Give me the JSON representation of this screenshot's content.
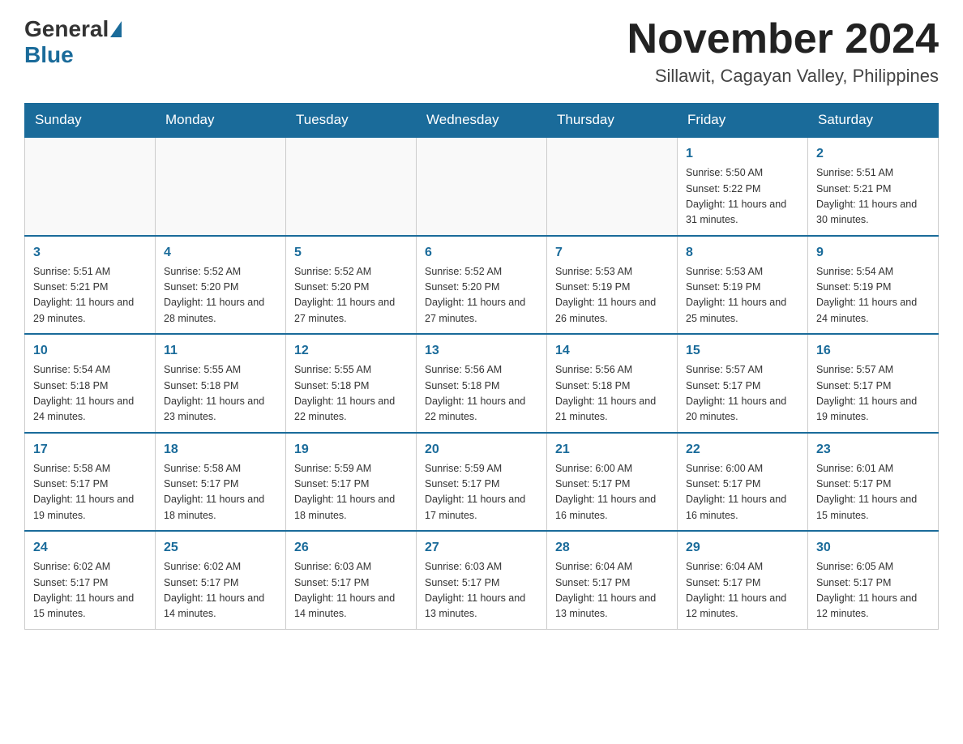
{
  "header": {
    "logo_general": "General",
    "logo_blue": "Blue",
    "month_title": "November 2024",
    "location": "Sillawit, Cagayan Valley, Philippines"
  },
  "weekdays": [
    "Sunday",
    "Monday",
    "Tuesday",
    "Wednesday",
    "Thursday",
    "Friday",
    "Saturday"
  ],
  "weeks": [
    [
      {
        "day": "",
        "info": ""
      },
      {
        "day": "",
        "info": ""
      },
      {
        "day": "",
        "info": ""
      },
      {
        "day": "",
        "info": ""
      },
      {
        "day": "",
        "info": ""
      },
      {
        "day": "1",
        "info": "Sunrise: 5:50 AM\nSunset: 5:22 PM\nDaylight: 11 hours and 31 minutes."
      },
      {
        "day": "2",
        "info": "Sunrise: 5:51 AM\nSunset: 5:21 PM\nDaylight: 11 hours and 30 minutes."
      }
    ],
    [
      {
        "day": "3",
        "info": "Sunrise: 5:51 AM\nSunset: 5:21 PM\nDaylight: 11 hours and 29 minutes."
      },
      {
        "day": "4",
        "info": "Sunrise: 5:52 AM\nSunset: 5:20 PM\nDaylight: 11 hours and 28 minutes."
      },
      {
        "day": "5",
        "info": "Sunrise: 5:52 AM\nSunset: 5:20 PM\nDaylight: 11 hours and 27 minutes."
      },
      {
        "day": "6",
        "info": "Sunrise: 5:52 AM\nSunset: 5:20 PM\nDaylight: 11 hours and 27 minutes."
      },
      {
        "day": "7",
        "info": "Sunrise: 5:53 AM\nSunset: 5:19 PM\nDaylight: 11 hours and 26 minutes."
      },
      {
        "day": "8",
        "info": "Sunrise: 5:53 AM\nSunset: 5:19 PM\nDaylight: 11 hours and 25 minutes."
      },
      {
        "day": "9",
        "info": "Sunrise: 5:54 AM\nSunset: 5:19 PM\nDaylight: 11 hours and 24 minutes."
      }
    ],
    [
      {
        "day": "10",
        "info": "Sunrise: 5:54 AM\nSunset: 5:18 PM\nDaylight: 11 hours and 24 minutes."
      },
      {
        "day": "11",
        "info": "Sunrise: 5:55 AM\nSunset: 5:18 PM\nDaylight: 11 hours and 23 minutes."
      },
      {
        "day": "12",
        "info": "Sunrise: 5:55 AM\nSunset: 5:18 PM\nDaylight: 11 hours and 22 minutes."
      },
      {
        "day": "13",
        "info": "Sunrise: 5:56 AM\nSunset: 5:18 PM\nDaylight: 11 hours and 22 minutes."
      },
      {
        "day": "14",
        "info": "Sunrise: 5:56 AM\nSunset: 5:18 PM\nDaylight: 11 hours and 21 minutes."
      },
      {
        "day": "15",
        "info": "Sunrise: 5:57 AM\nSunset: 5:17 PM\nDaylight: 11 hours and 20 minutes."
      },
      {
        "day": "16",
        "info": "Sunrise: 5:57 AM\nSunset: 5:17 PM\nDaylight: 11 hours and 19 minutes."
      }
    ],
    [
      {
        "day": "17",
        "info": "Sunrise: 5:58 AM\nSunset: 5:17 PM\nDaylight: 11 hours and 19 minutes."
      },
      {
        "day": "18",
        "info": "Sunrise: 5:58 AM\nSunset: 5:17 PM\nDaylight: 11 hours and 18 minutes."
      },
      {
        "day": "19",
        "info": "Sunrise: 5:59 AM\nSunset: 5:17 PM\nDaylight: 11 hours and 18 minutes."
      },
      {
        "day": "20",
        "info": "Sunrise: 5:59 AM\nSunset: 5:17 PM\nDaylight: 11 hours and 17 minutes."
      },
      {
        "day": "21",
        "info": "Sunrise: 6:00 AM\nSunset: 5:17 PM\nDaylight: 11 hours and 16 minutes."
      },
      {
        "day": "22",
        "info": "Sunrise: 6:00 AM\nSunset: 5:17 PM\nDaylight: 11 hours and 16 minutes."
      },
      {
        "day": "23",
        "info": "Sunrise: 6:01 AM\nSunset: 5:17 PM\nDaylight: 11 hours and 15 minutes."
      }
    ],
    [
      {
        "day": "24",
        "info": "Sunrise: 6:02 AM\nSunset: 5:17 PM\nDaylight: 11 hours and 15 minutes."
      },
      {
        "day": "25",
        "info": "Sunrise: 6:02 AM\nSunset: 5:17 PM\nDaylight: 11 hours and 14 minutes."
      },
      {
        "day": "26",
        "info": "Sunrise: 6:03 AM\nSunset: 5:17 PM\nDaylight: 11 hours and 14 minutes."
      },
      {
        "day": "27",
        "info": "Sunrise: 6:03 AM\nSunset: 5:17 PM\nDaylight: 11 hours and 13 minutes."
      },
      {
        "day": "28",
        "info": "Sunrise: 6:04 AM\nSunset: 5:17 PM\nDaylight: 11 hours and 13 minutes."
      },
      {
        "day": "29",
        "info": "Sunrise: 6:04 AM\nSunset: 5:17 PM\nDaylight: 11 hours and 12 minutes."
      },
      {
        "day": "30",
        "info": "Sunrise: 6:05 AM\nSunset: 5:17 PM\nDaylight: 11 hours and 12 minutes."
      }
    ]
  ]
}
